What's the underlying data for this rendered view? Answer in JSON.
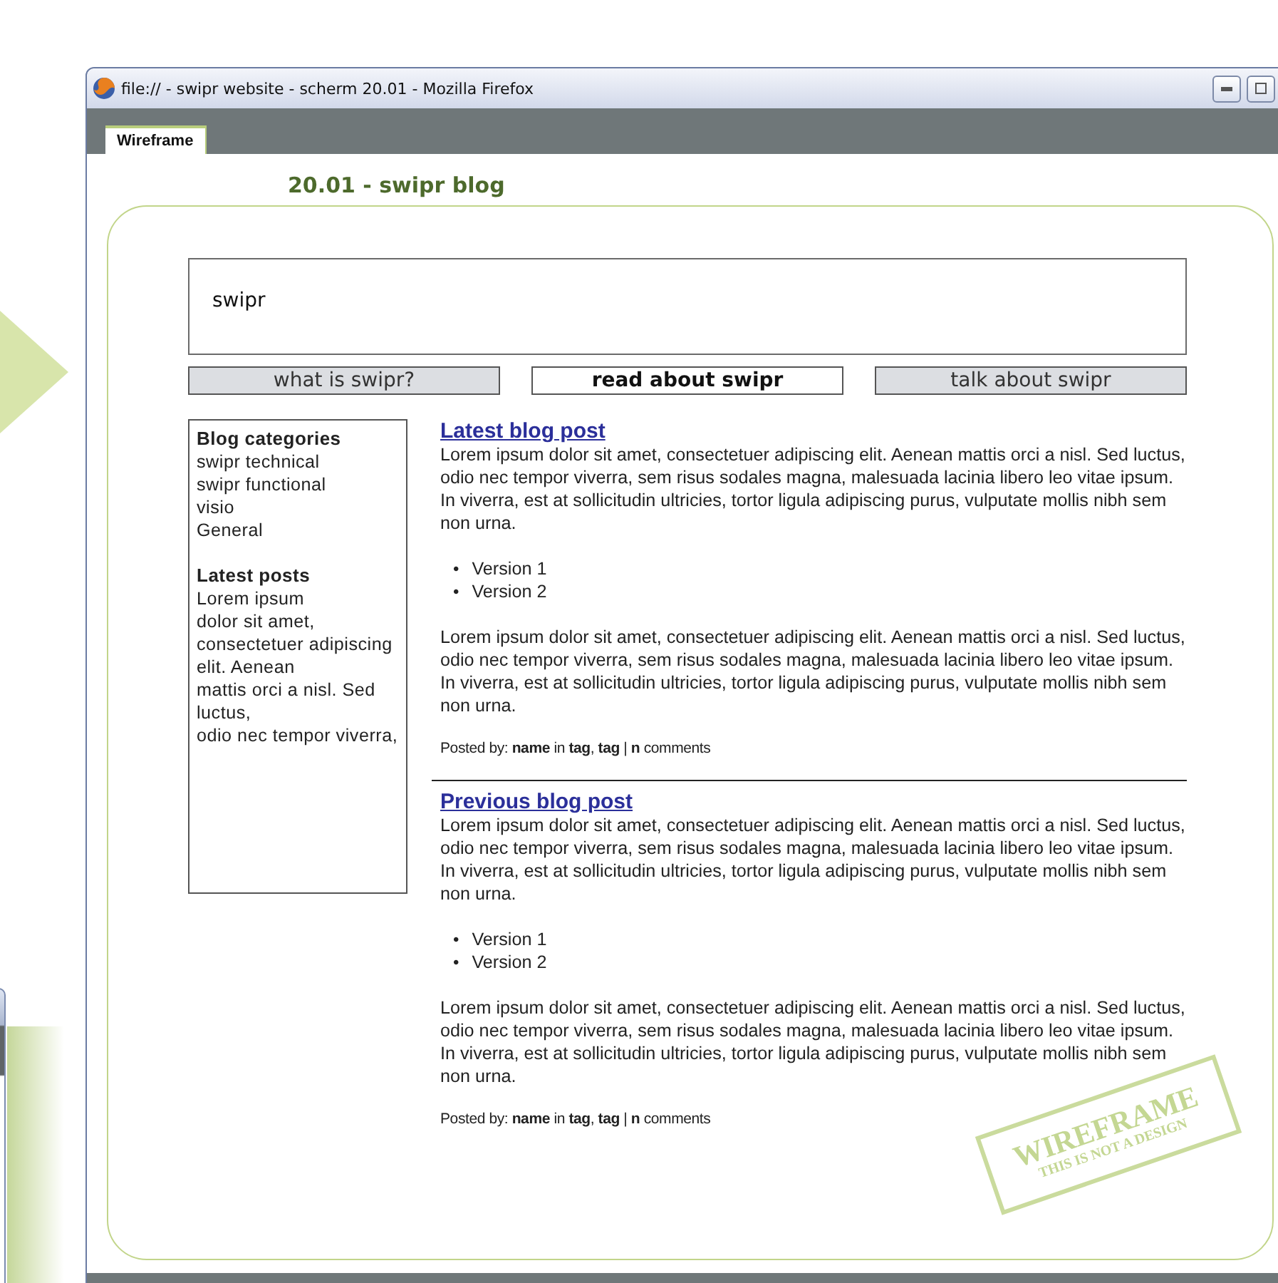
{
  "window": {
    "title": "file:// - swipr website - scherm 20.01 - Mozilla Firefox"
  },
  "tabs": [
    {
      "label": "Wireframe",
      "selected": true
    }
  ],
  "page": {
    "heading": "20.01 - swipr blog"
  },
  "header": {
    "title": "swipr"
  },
  "nav": [
    {
      "label": "what is swipr?",
      "selected": false
    },
    {
      "label": "read about swipr",
      "selected": true
    },
    {
      "label": "talk about swipr",
      "selected": false
    }
  ],
  "sidebar": {
    "sections": [
      {
        "title": "Blog categories",
        "items": [
          "swipr technical",
          "swipr functional",
          "visio",
          "General"
        ]
      },
      {
        "title": "Latest posts",
        "items": [
          "Lorem ipsum",
          "dolor sit amet,",
          "consectetuer adipiscing elit. Aenean",
          "mattis orci a nisl. Sed luctus,",
          "odio nec tempor viverra,"
        ]
      }
    ]
  },
  "posts": [
    {
      "title": "Latest blog post",
      "intro": "Lorem ipsum dolor sit amet, consectetuer adipiscing elit. Aenean mattis orci a nisl. Sed luctus, odio nec tempor viverra, sem risus sodales magna, malesuada lacinia libero leo vitae ipsum. In viverra, est at sollicitudin ultricies, tortor ligula adipiscing purus, vulputate mollis nibh sem non urna.",
      "bullets": [
        {
          "marker": "•",
          "text": "Version 1"
        },
        {
          "marker": "•",
          "text": "Version 2"
        }
      ],
      "body": "Lorem ipsum dolor sit amet, consectetuer adipiscing elit. Aenean mattis orci a nisl. Sed luctus, odio nec tempor viverra, sem risus sodales magna, malesuada lacinia libero leo vitae ipsum. In viverra, est at sollicitudin ultricies, tortor ligula adipiscing purus, vulputate mollis nibh sem non urna.",
      "meta": "Posted by: **name** in **tag**, **tag** | **n** comments"
    },
    {
      "title": "Previous blog post",
      "intro": "Lorem ipsum dolor sit amet, consectetuer adipiscing elit. Aenean mattis orci a nisl. Sed luctus, odio nec tempor viverra, sem risus sodales magna, malesuada lacinia libero leo vitae ipsum. In viverra, est at sollicitudin ultricies, tortor ligula adipiscing purus, vulputate mollis nibh sem non urna.",
      "bullets": [
        {
          "marker": "•",
          "text": "Version 1"
        },
        {
          "marker": "•",
          "text": "Version 2"
        }
      ],
      "body": "Lorem ipsum dolor sit amet, consectetuer adipiscing elit. Aenean mattis orci a nisl. Sed luctus, odio nec tempor viverra, sem risus sodales magna, malesuada lacinia libero leo vitae ipsum. In viverra, est at sollicitudin ultricies, tortor ligula adipiscing purus, vulputate mollis nibh sem non urna.",
      "meta": "Posted by: **name** in **tag**, **tag** | **n** comments"
    }
  ],
  "stamp": {
    "title": "WIREFRAME",
    "subtitle": "THIS IS NOT A DESIGN"
  }
}
